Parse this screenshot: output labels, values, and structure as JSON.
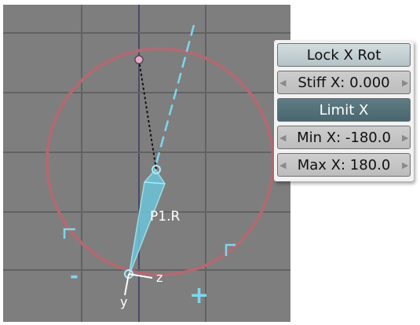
{
  "panel": {
    "lock_x_rot": "Lock X Rot",
    "stiff_x": "Stiff X: 0.000",
    "limit_x": "Limit X",
    "min_x": "Min X: -180.0",
    "max_x": "Max X: 180.0"
  },
  "viewport": {
    "bone_name": "P1.R",
    "axis_z": "z",
    "axis_y": "y",
    "minus_sign": "-",
    "plus_sign": "+"
  },
  "colors": {
    "viewport_bg": "#7e7e7e",
    "grid": "#626262",
    "limit_circle": "#b06a72",
    "bone": "#7fd6ec",
    "toggle_on": "#56727a",
    "toggle_off": "#c8d2d6"
  }
}
